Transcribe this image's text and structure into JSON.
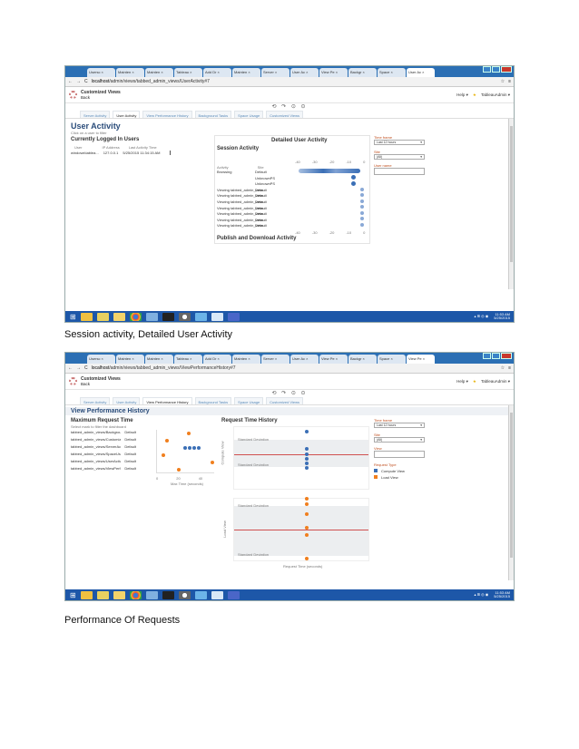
{
  "screenshot1": {
    "tabs": [
      "Usersc ×",
      "Mainten ×",
      "Mainten ×",
      "Tableau ×",
      "Add Dr ×",
      "Mainten ×",
      "Server ×",
      "User Ac ×",
      "View Pe ×",
      "Backgr ×",
      "Space ×",
      "User Ac ×"
    ],
    "url_host": "localhost",
    "url_path": "/admin/views/tabbed_admin_views/UserActivity#7",
    "app_title": "Customized Views",
    "app_back": "Back",
    "help": "Help ▾",
    "user": "TableauAdmin ▾",
    "controls": "⟲ ↷ ⊙ ⊙",
    "navtabs": [
      "Server Activity",
      "User Activity",
      "View Performance History",
      "Background Tasks",
      "Space Usage",
      "Customized Views"
    ],
    "heading": "User Activity",
    "subheading": "Click on a user to filter",
    "logged_in_title": "Currently Logged In Users",
    "logged_in_columns": [
      "User",
      "IP Address",
      "Last Activity Time"
    ],
    "logged_in_row": [
      "windows\\tablea...",
      "127.0.0.1",
      "5/25/2015 11:34:15 AM"
    ],
    "detailed_title": "Detailed User Activity",
    "session_title": "Session Activity",
    "session_columns": [
      "Activity",
      "Site"
    ],
    "session_rows": [
      [
        "Browsing",
        "Default"
      ],
      [
        "",
        "UnknownPS"
      ],
      [
        "",
        "UnknownPS"
      ],
      [
        "Viewing tabbed_admin_view...",
        "Default"
      ],
      [
        "Viewing tabbed_admin_view...",
        "Default"
      ],
      [
        "Viewing tabbed_admin_view...",
        "Default"
      ],
      [
        "Viewing tabbed_admin_view...",
        "Default"
      ],
      [
        "Viewing tabbed_admin_view...",
        "Default"
      ],
      [
        "Viewing tabbed_admin_view...",
        "Default"
      ],
      [
        "Viewing tabbed_admin_view...",
        "Default"
      ]
    ],
    "axis_ticks": [
      "-40",
      "-30",
      "-20",
      "-10",
      "0"
    ],
    "time_frame_label": "Time frame",
    "time_frame_value": "Last 12 hours",
    "site_label": "Site",
    "site_value": "(All)",
    "user_name_label": "User name",
    "publish_title": "Publish and Download Activity",
    "clock_time": "11:53 AM",
    "clock_date": "5/25/2015"
  },
  "caption1": "Session activity, Detailed User Activity",
  "screenshot2": {
    "tabs": [
      "Usersc ×",
      "Mainten ×",
      "Mainten ×",
      "Tableau ×",
      "Add Dr ×",
      "Mainten ×",
      "Server ×",
      "User Ac ×",
      "View Pe ×",
      "Backgr ×",
      "Space ×",
      "View Pe ×"
    ],
    "url_host": "localhost",
    "url_path": "/admin/views/tabbed_admin_views/ViewPerformanceHistory#7",
    "app_title": "Customized Views",
    "app_back": "Back",
    "help": "Help ▾",
    "user": "TableauAdmin ▾",
    "controls": "⟲ ↷ ⊙ ⊙",
    "navtabs": [
      "Server Activity",
      "User Activity",
      "View Performance History",
      "Background Tasks",
      "Space Usage",
      "Customized Views"
    ],
    "heading": "View Performance History",
    "max_title": "Maximum Request Time",
    "max_sub": "Select mark to filter the dashboard",
    "max_rows": [
      [
        "tabbed_admin_views/Background...",
        "Default"
      ],
      [
        "tabbed_admin_views/Customized...",
        "Default"
      ],
      [
        "tabbed_admin_views/ServerActivi...",
        "Default"
      ],
      [
        "tabbed_admin_views/SpaceUsage",
        "Default"
      ],
      [
        "tabbed_admin_views/UserActivity",
        "Default"
      ],
      [
        "tabbed_admin_views/ViewPerfor...",
        "Default"
      ]
    ],
    "max_ticks": [
      "0",
      "20",
      "40"
    ],
    "max_xlabel": "Max Time (seconds)",
    "history_title": "Request Time History",
    "std_dev": "Standard Deviation",
    "compute_view_axis": "Compute View",
    "load_view_axis": "Load View",
    "request_time_axis": "Request Time (seconds)",
    "time_frame_label": "Time frame",
    "time_frame_value": "Last 12 hours",
    "site_label": "Site",
    "site_value": "(All)",
    "view_label": "View",
    "request_type_label": "Request Type",
    "legend": [
      {
        "label": "Compute View",
        "color": "#3b6fb6"
      },
      {
        "label": "Load View",
        "color": "#f07f1e"
      }
    ],
    "history_xlabel": "Request Time (seconds)",
    "clock_time": "11:53 AM",
    "clock_date": "5/25/2015"
  },
  "caption2": "Performance Of Requests"
}
